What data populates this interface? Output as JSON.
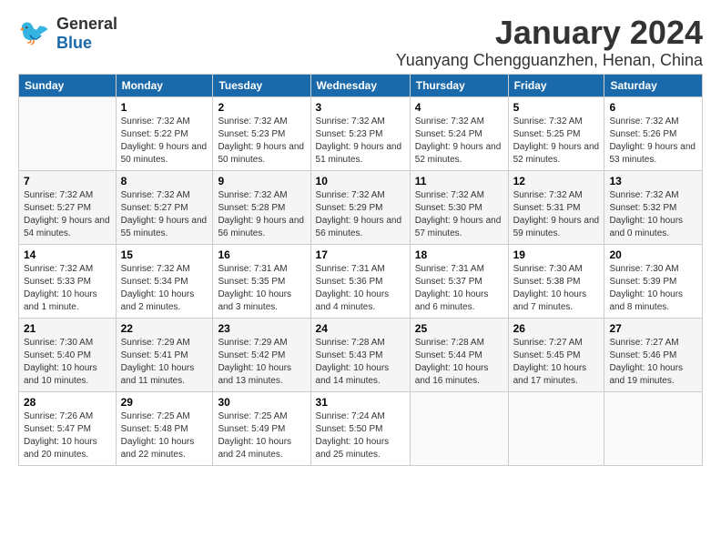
{
  "logo": {
    "general": "General",
    "blue": "Blue"
  },
  "title": "January 2024",
  "location": "Yuanyang Chengguanzhen, Henan, China",
  "days_of_week": [
    "Sunday",
    "Monday",
    "Tuesday",
    "Wednesday",
    "Thursday",
    "Friday",
    "Saturday"
  ],
  "weeks": [
    [
      {
        "day": "",
        "sunrise": "",
        "sunset": "",
        "daylight": ""
      },
      {
        "day": "1",
        "sunrise": "Sunrise: 7:32 AM",
        "sunset": "Sunset: 5:22 PM",
        "daylight": "Daylight: 9 hours and 50 minutes."
      },
      {
        "day": "2",
        "sunrise": "Sunrise: 7:32 AM",
        "sunset": "Sunset: 5:23 PM",
        "daylight": "Daylight: 9 hours and 50 minutes."
      },
      {
        "day": "3",
        "sunrise": "Sunrise: 7:32 AM",
        "sunset": "Sunset: 5:23 PM",
        "daylight": "Daylight: 9 hours and 51 minutes."
      },
      {
        "day": "4",
        "sunrise": "Sunrise: 7:32 AM",
        "sunset": "Sunset: 5:24 PM",
        "daylight": "Daylight: 9 hours and 52 minutes."
      },
      {
        "day": "5",
        "sunrise": "Sunrise: 7:32 AM",
        "sunset": "Sunset: 5:25 PM",
        "daylight": "Daylight: 9 hours and 52 minutes."
      },
      {
        "day": "6",
        "sunrise": "Sunrise: 7:32 AM",
        "sunset": "Sunset: 5:26 PM",
        "daylight": "Daylight: 9 hours and 53 minutes."
      }
    ],
    [
      {
        "day": "7",
        "sunrise": "Sunrise: 7:32 AM",
        "sunset": "Sunset: 5:27 PM",
        "daylight": "Daylight: 9 hours and 54 minutes."
      },
      {
        "day": "8",
        "sunrise": "Sunrise: 7:32 AM",
        "sunset": "Sunset: 5:27 PM",
        "daylight": "Daylight: 9 hours and 55 minutes."
      },
      {
        "day": "9",
        "sunrise": "Sunrise: 7:32 AM",
        "sunset": "Sunset: 5:28 PM",
        "daylight": "Daylight: 9 hours and 56 minutes."
      },
      {
        "day": "10",
        "sunrise": "Sunrise: 7:32 AM",
        "sunset": "Sunset: 5:29 PM",
        "daylight": "Daylight: 9 hours and 56 minutes."
      },
      {
        "day": "11",
        "sunrise": "Sunrise: 7:32 AM",
        "sunset": "Sunset: 5:30 PM",
        "daylight": "Daylight: 9 hours and 57 minutes."
      },
      {
        "day": "12",
        "sunrise": "Sunrise: 7:32 AM",
        "sunset": "Sunset: 5:31 PM",
        "daylight": "Daylight: 9 hours and 59 minutes."
      },
      {
        "day": "13",
        "sunrise": "Sunrise: 7:32 AM",
        "sunset": "Sunset: 5:32 PM",
        "daylight": "Daylight: 10 hours and 0 minutes."
      }
    ],
    [
      {
        "day": "14",
        "sunrise": "Sunrise: 7:32 AM",
        "sunset": "Sunset: 5:33 PM",
        "daylight": "Daylight: 10 hours and 1 minute."
      },
      {
        "day": "15",
        "sunrise": "Sunrise: 7:32 AM",
        "sunset": "Sunset: 5:34 PM",
        "daylight": "Daylight: 10 hours and 2 minutes."
      },
      {
        "day": "16",
        "sunrise": "Sunrise: 7:31 AM",
        "sunset": "Sunset: 5:35 PM",
        "daylight": "Daylight: 10 hours and 3 minutes."
      },
      {
        "day": "17",
        "sunrise": "Sunrise: 7:31 AM",
        "sunset": "Sunset: 5:36 PM",
        "daylight": "Daylight: 10 hours and 4 minutes."
      },
      {
        "day": "18",
        "sunrise": "Sunrise: 7:31 AM",
        "sunset": "Sunset: 5:37 PM",
        "daylight": "Daylight: 10 hours and 6 minutes."
      },
      {
        "day": "19",
        "sunrise": "Sunrise: 7:30 AM",
        "sunset": "Sunset: 5:38 PM",
        "daylight": "Daylight: 10 hours and 7 minutes."
      },
      {
        "day": "20",
        "sunrise": "Sunrise: 7:30 AM",
        "sunset": "Sunset: 5:39 PM",
        "daylight": "Daylight: 10 hours and 8 minutes."
      }
    ],
    [
      {
        "day": "21",
        "sunrise": "Sunrise: 7:30 AM",
        "sunset": "Sunset: 5:40 PM",
        "daylight": "Daylight: 10 hours and 10 minutes."
      },
      {
        "day": "22",
        "sunrise": "Sunrise: 7:29 AM",
        "sunset": "Sunset: 5:41 PM",
        "daylight": "Daylight: 10 hours and 11 minutes."
      },
      {
        "day": "23",
        "sunrise": "Sunrise: 7:29 AM",
        "sunset": "Sunset: 5:42 PM",
        "daylight": "Daylight: 10 hours and 13 minutes."
      },
      {
        "day": "24",
        "sunrise": "Sunrise: 7:28 AM",
        "sunset": "Sunset: 5:43 PM",
        "daylight": "Daylight: 10 hours and 14 minutes."
      },
      {
        "day": "25",
        "sunrise": "Sunrise: 7:28 AM",
        "sunset": "Sunset: 5:44 PM",
        "daylight": "Daylight: 10 hours and 16 minutes."
      },
      {
        "day": "26",
        "sunrise": "Sunrise: 7:27 AM",
        "sunset": "Sunset: 5:45 PM",
        "daylight": "Daylight: 10 hours and 17 minutes."
      },
      {
        "day": "27",
        "sunrise": "Sunrise: 7:27 AM",
        "sunset": "Sunset: 5:46 PM",
        "daylight": "Daylight: 10 hours and 19 minutes."
      }
    ],
    [
      {
        "day": "28",
        "sunrise": "Sunrise: 7:26 AM",
        "sunset": "Sunset: 5:47 PM",
        "daylight": "Daylight: 10 hours and 20 minutes."
      },
      {
        "day": "29",
        "sunrise": "Sunrise: 7:25 AM",
        "sunset": "Sunset: 5:48 PM",
        "daylight": "Daylight: 10 hours and 22 minutes."
      },
      {
        "day": "30",
        "sunrise": "Sunrise: 7:25 AM",
        "sunset": "Sunset: 5:49 PM",
        "daylight": "Daylight: 10 hours and 24 minutes."
      },
      {
        "day": "31",
        "sunrise": "Sunrise: 7:24 AM",
        "sunset": "Sunset: 5:50 PM",
        "daylight": "Daylight: 10 hours and 25 minutes."
      },
      {
        "day": "",
        "sunrise": "",
        "sunset": "",
        "daylight": ""
      },
      {
        "day": "",
        "sunrise": "",
        "sunset": "",
        "daylight": ""
      },
      {
        "day": "",
        "sunrise": "",
        "sunset": "",
        "daylight": ""
      }
    ]
  ]
}
